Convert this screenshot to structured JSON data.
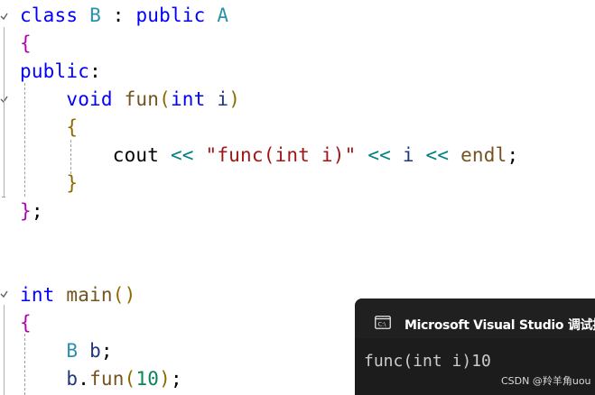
{
  "code_lines": [
    [
      {
        "t": "class",
        "c": "kw"
      },
      {
        "t": " ",
        "c": "plain"
      },
      {
        "t": "B",
        "c": "ty"
      },
      {
        "t": " : ",
        "c": "plain"
      },
      {
        "t": "public",
        "c": "kw"
      },
      {
        "t": " ",
        "c": "plain"
      },
      {
        "t": "A",
        "c": "ty"
      }
    ],
    [
      {
        "t": "{",
        "c": "brm"
      }
    ],
    [
      {
        "t": "public",
        "c": "kw"
      },
      {
        "t": ":",
        "c": "plain"
      }
    ],
    [
      {
        "t": "    ",
        "c": "plain"
      },
      {
        "t": "void",
        "c": "kw"
      },
      {
        "t": " ",
        "c": "plain"
      },
      {
        "t": "fun",
        "c": "fn"
      },
      {
        "t": "(",
        "c": "bry"
      },
      {
        "t": "int",
        "c": "kw"
      },
      {
        "t": " ",
        "c": "plain"
      },
      {
        "t": "i",
        "c": "var"
      },
      {
        "t": ")",
        "c": "bry"
      }
    ],
    [
      {
        "t": "    ",
        "c": "plain"
      },
      {
        "t": "{",
        "c": "bry"
      }
    ],
    [
      {
        "t": "        ",
        "c": "plain"
      },
      {
        "t": "cout",
        "c": "plain"
      },
      {
        "t": " ",
        "c": "plain"
      },
      {
        "t": "<<",
        "c": "op"
      },
      {
        "t": " ",
        "c": "plain"
      },
      {
        "t": "\"func(int i)\"",
        "c": "str"
      },
      {
        "t": " ",
        "c": "plain"
      },
      {
        "t": "<<",
        "c": "op"
      },
      {
        "t": " ",
        "c": "plain"
      },
      {
        "t": "i",
        "c": "var"
      },
      {
        "t": " ",
        "c": "plain"
      },
      {
        "t": "<<",
        "c": "op"
      },
      {
        "t": " ",
        "c": "plain"
      },
      {
        "t": "endl",
        "c": "fn"
      },
      {
        "t": ";",
        "c": "plain"
      }
    ],
    [
      {
        "t": "    ",
        "c": "plain"
      },
      {
        "t": "}",
        "c": "bry"
      }
    ],
    [
      {
        "t": "}",
        "c": "brm"
      },
      {
        "t": ";",
        "c": "plain"
      }
    ],
    [],
    [],
    [
      {
        "t": "int",
        "c": "kw"
      },
      {
        "t": " ",
        "c": "plain"
      },
      {
        "t": "main",
        "c": "fn"
      },
      {
        "t": "()",
        "c": "bry"
      }
    ],
    [
      {
        "t": "{",
        "c": "brm"
      }
    ],
    [
      {
        "t": "    ",
        "c": "plain"
      },
      {
        "t": "B",
        "c": "ty"
      },
      {
        "t": " ",
        "c": "plain"
      },
      {
        "t": "b",
        "c": "var"
      },
      {
        "t": ";",
        "c": "plain"
      }
    ],
    [
      {
        "t": "    ",
        "c": "plain"
      },
      {
        "t": "b",
        "c": "var"
      },
      {
        "t": ".",
        "c": "plain"
      },
      {
        "t": "fun",
        "c": "fn"
      },
      {
        "t": "(",
        "c": "bry"
      },
      {
        "t": "10",
        "c": "num"
      },
      {
        "t": ")",
        "c": "bry"
      },
      {
        "t": ";",
        "c": "plain"
      }
    ]
  ],
  "console": {
    "title": "Microsoft Visual Studio 调试控",
    "output": "func(int i)10"
  },
  "watermark": "CSDN @羚羊角uou"
}
